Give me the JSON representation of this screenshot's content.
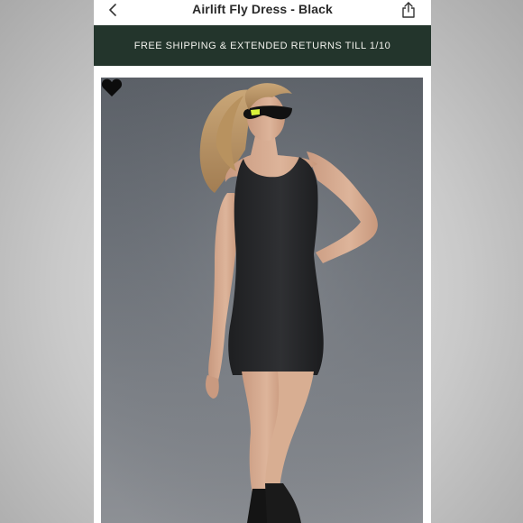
{
  "header": {
    "title": "Airlift Fly Dress - Black",
    "back_icon": "chevron-left-icon",
    "share_icon": "share-icon"
  },
  "promo_banner": {
    "text": "FREE SHIPPING & EXTENDED RETURNS TILL 1/10",
    "background_color": "#23352c"
  },
  "product": {
    "favorite_icon": "heart-icon"
  }
}
